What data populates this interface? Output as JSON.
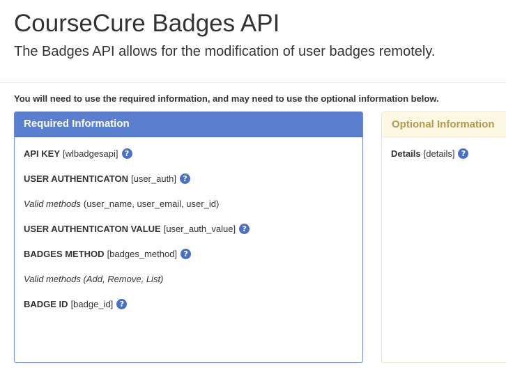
{
  "header": {
    "title": "CourseCure Badges API",
    "subtitle": "The Badges API allows for the modification of user badges remotely."
  },
  "instructions": "You will need to use the required information, and may need to use the optional information below.",
  "required_panel": {
    "heading": "Required Information",
    "fields": [
      {
        "name": "API KEY",
        "key": "[wlbadgesapi]",
        "help": "?"
      },
      {
        "name": "USER AUTHENTICATON",
        "key": "[user_auth]",
        "help": "?"
      },
      {
        "note_italic": "Valid methods",
        "note_tail": "(user_name, user_email, user_id)"
      },
      {
        "name": "USER AUTHENTICATON VALUE",
        "key": "[user_auth_value]",
        "help": "?"
      },
      {
        "name": "BADGES METHOD",
        "key": "[badges_method]",
        "help": "?"
      },
      {
        "note_italic": "Valid methods (Add, Remove, List)"
      },
      {
        "name": "BADGE ID",
        "key": "[badge_id]",
        "help": "?"
      }
    ]
  },
  "optional_panel": {
    "heading": "Optional Information",
    "fields": [
      {
        "name": "Details",
        "key": "[details]",
        "help": "?"
      }
    ]
  },
  "colors": {
    "required_heading_bg": "#5b7fcf",
    "optional_heading_bg": "#fcf8e3",
    "optional_heading_text": "#b49a4e",
    "help_icon": "#4a6fc7"
  },
  "icons": {
    "help": "question-circle-icon"
  }
}
